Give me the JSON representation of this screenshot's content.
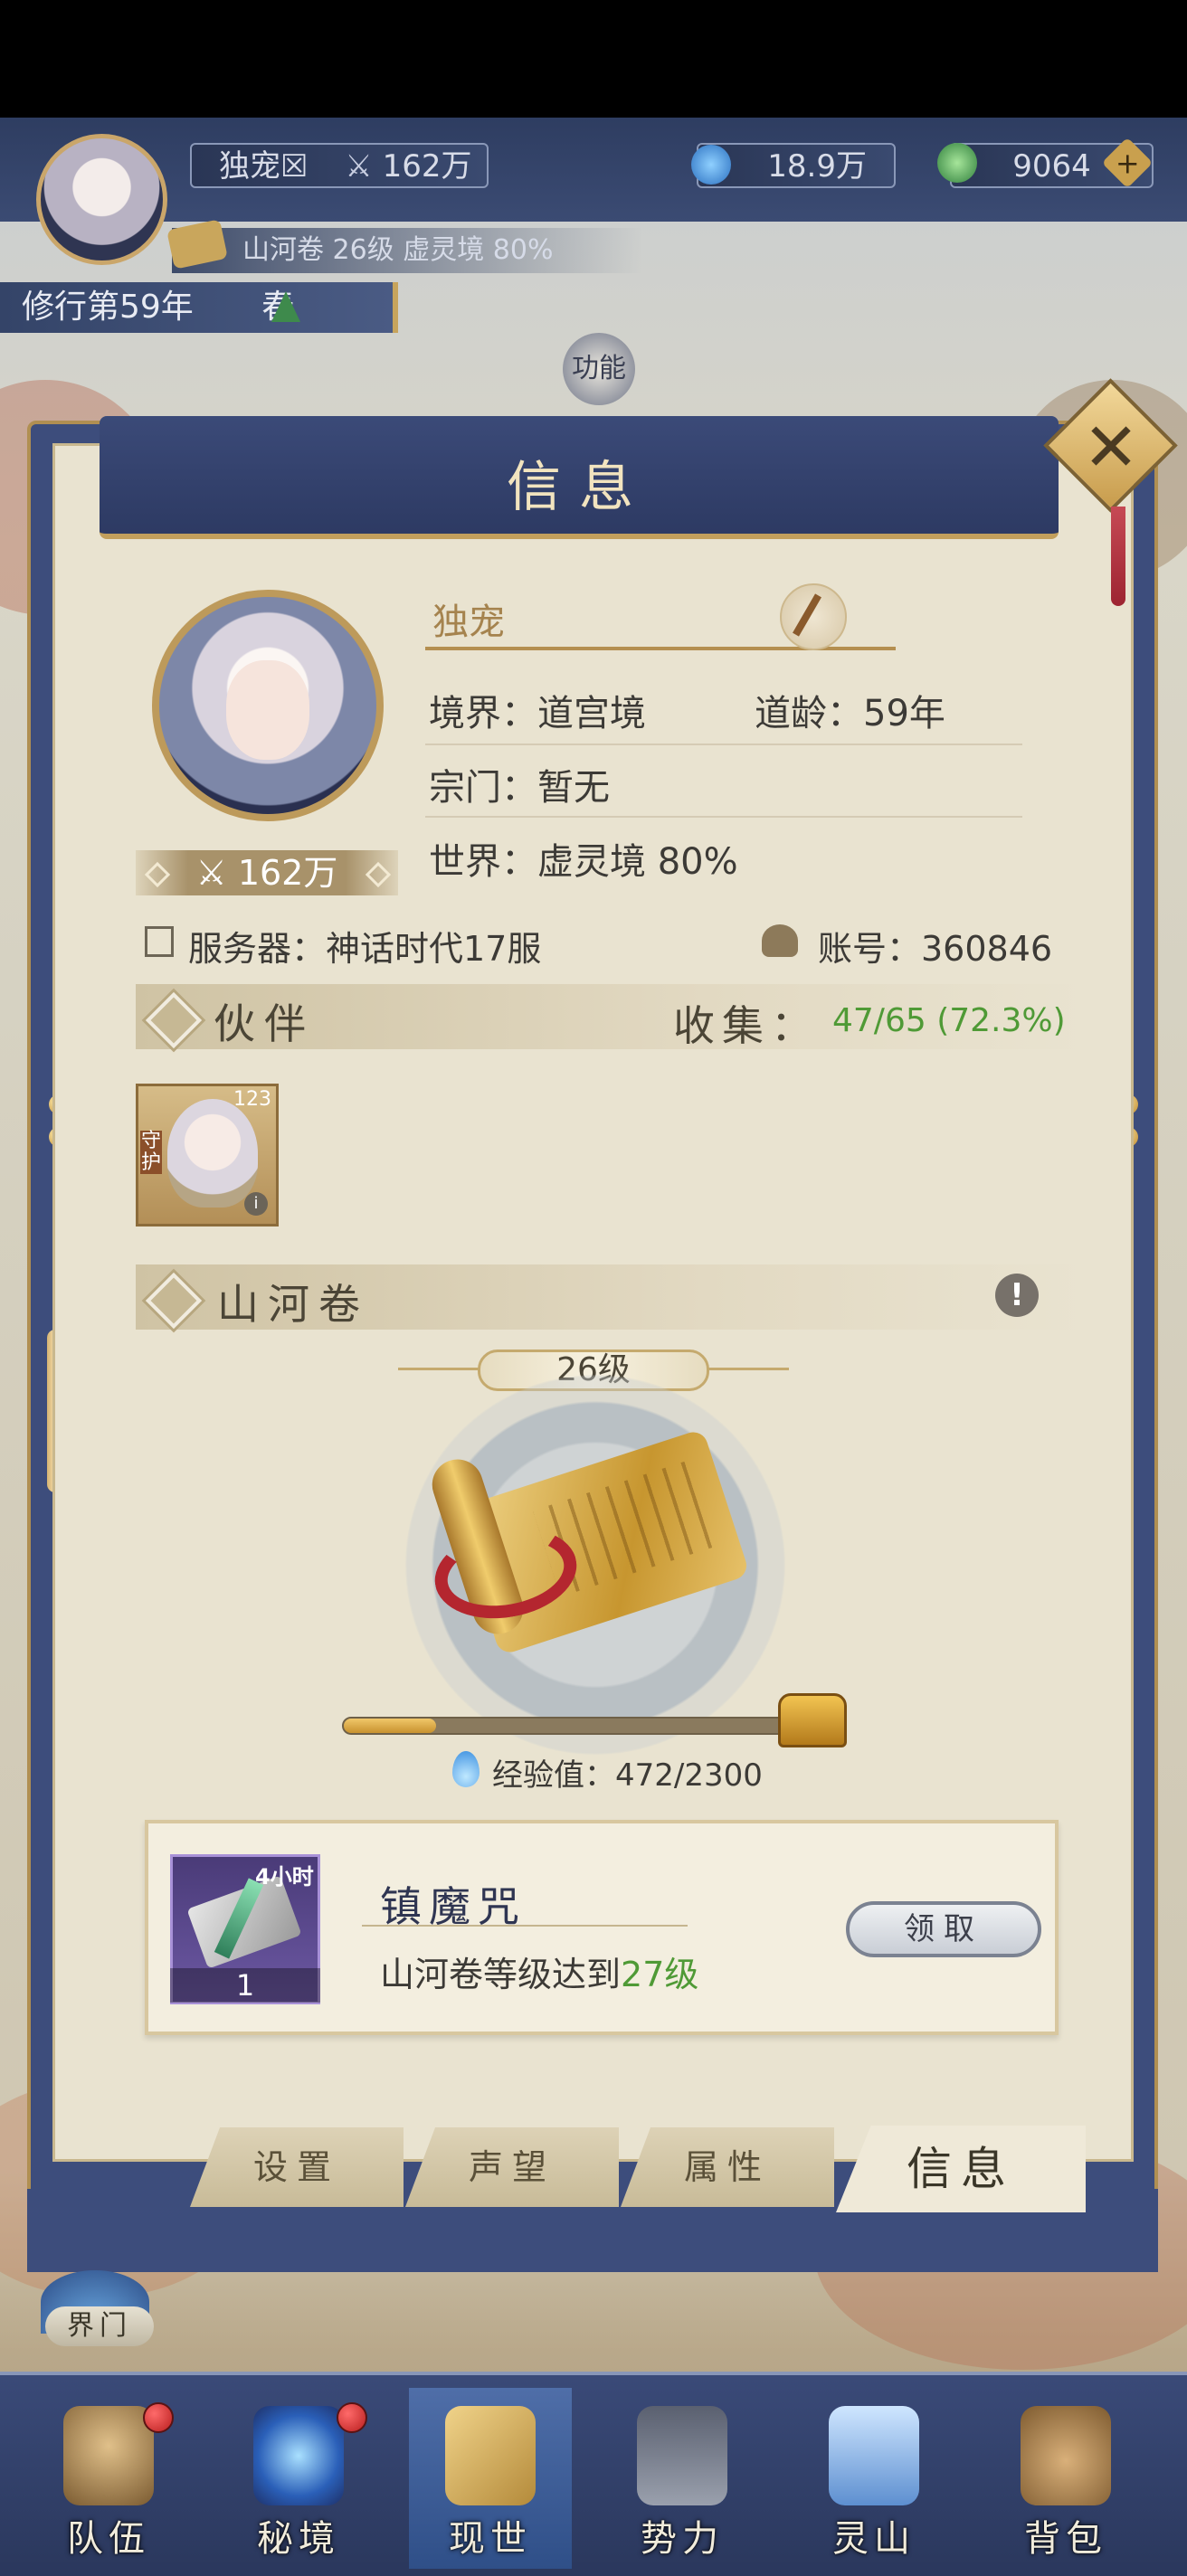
{
  "colors": {
    "frame_blue": "#3d4d7c",
    "gold": "#c29f5c",
    "parchment": "#e9e3d0",
    "highlight_green": "#4f9a36"
  },
  "top": {
    "nickname": "独宠☒",
    "power": "162万",
    "spirit_stones": "18.9万",
    "jade": "9064",
    "scroll_status": "山河卷 26级 虚灵境 80%",
    "cultivation_year": "修行第59年",
    "season": "春",
    "function_button": "功能"
  },
  "panel": {
    "title": "信息",
    "profile": {
      "name": "独宠",
      "power_badge": "162万",
      "realm": "境界：道宫境",
      "age": "道龄：59年",
      "sect": "宗门：暂无",
      "world": "世界：虚灵境  80%",
      "server": "服务器：神话时代17服",
      "account": "账号：360846"
    },
    "partners": {
      "section_title": "伙伴",
      "collect_label": "收集：",
      "collect_value": "47/65 (72.3%)",
      "card": {
        "level": "123",
        "role": "守护"
      }
    },
    "scroll": {
      "section_title": "山河卷",
      "level": "26级",
      "exp_label": "经验值：472/2300",
      "exp_progress": 0.205
    },
    "reward": {
      "duration": "4小时",
      "count": "1",
      "name": "镇魔咒",
      "desc_prefix": "山河卷等级达到",
      "desc_level": "27级",
      "claim": "领取"
    },
    "tabs": [
      "设置",
      "声望",
      "属性",
      "信息"
    ],
    "active_tab": "信息"
  },
  "realm_gate": "界门",
  "nav": [
    "队伍",
    "秘境",
    "现世",
    "势力",
    "灵山",
    "背包"
  ]
}
